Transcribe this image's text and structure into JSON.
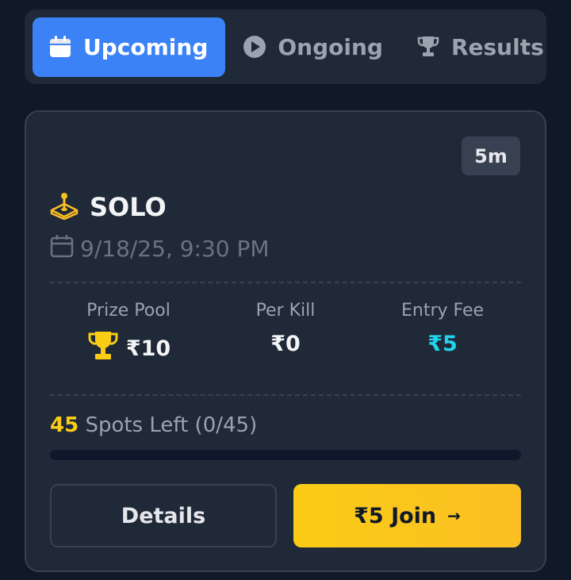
{
  "tabs": [
    {
      "label": "Upcoming",
      "icon": "calendar-icon",
      "active": true
    },
    {
      "label": "Ongoing",
      "icon": "play-icon",
      "active": false
    },
    {
      "label": "Results",
      "icon": "trophy-icon",
      "active": false
    }
  ],
  "match": {
    "time_left": "5m",
    "mode": "SOLO",
    "mode_icon": "joystick-icon",
    "datetime": "9/18/25, 9:30 PM",
    "stats": {
      "prize_pool": {
        "label": "Prize Pool",
        "value": "₹10"
      },
      "per_kill": {
        "label": "Per Kill",
        "value": "₹0"
      },
      "entry_fee": {
        "label": "Entry Fee",
        "value": "₹5"
      }
    },
    "spots": {
      "left": "45",
      "text": " Spots Left (0/45)",
      "filled_fraction": 0
    },
    "buttons": {
      "details": "Details",
      "join": "₹5 Join",
      "join_arrow": "→"
    }
  },
  "colors": {
    "accent_blue": "#3b82f6",
    "accent_yellow": "#facc15",
    "accent_cyan": "#22d3ee",
    "background": "#111827",
    "card": "#1f2937"
  }
}
